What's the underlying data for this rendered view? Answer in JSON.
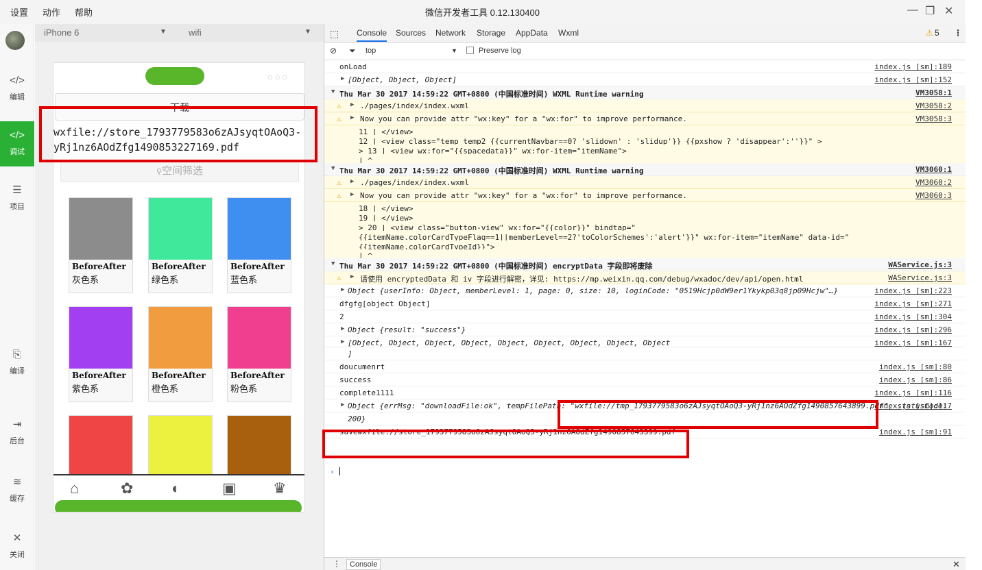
{
  "menu": [
    "设置",
    "动作",
    "帮助"
  ],
  "window_title": "微信开发者工具 0.12.130400",
  "sidebar": [
    {
      "label": "编辑",
      "icon": "code-bracket-icon"
    },
    {
      "label": "调试",
      "icon": "code-slash-icon"
    },
    {
      "label": "项目",
      "icon": "list-icon"
    },
    {
      "label": "编译",
      "icon": "compile-icon"
    },
    {
      "label": "后台",
      "icon": "background-icon"
    },
    {
      "label": "缓存",
      "icon": "layers-icon"
    },
    {
      "label": "关闭",
      "icon": "close-icon"
    }
  ],
  "simulator": {
    "device": "iPhone 6",
    "network": "wifi",
    "download_label": "下载",
    "file_path": "wxfile://store_1793779583o6zAJsyqtOAoQ3-yRj1nz6AOdZfg1490853227169.pdf",
    "filter_label": "空间筛选",
    "cards": [
      {
        "title": "BeforeAfter",
        "name": "灰色系",
        "color": "#8c8c8c"
      },
      {
        "title": "BeforeAfter",
        "name": "绿色系",
        "color": "#3fe89a"
      },
      {
        "title": "BeforeAfter",
        "name": "蓝色系",
        "color": "#3f8ff0"
      },
      {
        "title": "BeforeAfter",
        "name": "紫色系",
        "color": "#a23ff0"
      },
      {
        "title": "BeforeAfter",
        "name": "橙色系",
        "color": "#f09c3f"
      },
      {
        "title": "BeforeAfter",
        "name": "粉色系",
        "color": "#f03f8f"
      },
      {
        "title": "",
        "name": "",
        "color": "#f04545"
      },
      {
        "title": "",
        "name": "",
        "color": "#ecf03f"
      },
      {
        "title": "",
        "name": "",
        "color": "#a8600f"
      }
    ]
  },
  "devtools": {
    "tabs": [
      "Console",
      "Sources",
      "Network",
      "Storage",
      "AppData",
      "Wxml"
    ],
    "warning_count": "5",
    "context": "top",
    "preserve_log": "Preserve log",
    "bottom_tab": "Console",
    "lines": [
      {
        "text": "onLoad",
        "src": "index.js [sm]:189"
      },
      {
        "text": "[Object, Object, Object]",
        "src": "index.js [sm]:152"
      },
      {
        "text": "Thu Mar 30 2017 14:59:22 GMT+0800 (中国标准时间) WXML Runtime warning",
        "src": "VM3058:1"
      },
      {
        "text": "./pages/index/index.wxml",
        "src": "VM3058:2"
      },
      {
        "text": "Now you can provide attr \"wx:key\" for a \"wx:for\" to improve performance.",
        "src": "VM3058:3"
      },
      {
        "text": "  11 | </view>"
      },
      {
        "text": "  12 | <view class=\"temp temp2 {{currentNavbar==0? 'slidown' : 'slidup'}} {{pxshow ? 'disappear':''}}\"  >"
      },
      {
        "text": "> 13 | <view wx:for=\"{{spacedata}}\" wx:for-item=\"itemName\">"
      },
      {
        "text": "     |  ^"
      },
      {
        "text": "Thu Mar 30 2017 14:59:22 GMT+0800 (中国标准时间) WXML Runtime warning",
        "src": "VM3060:1"
      },
      {
        "text": "./pages/index/index.wxml",
        "src": "VM3060:2"
      },
      {
        "text": "Now you can provide attr \"wx:key\" for a \"wx:for\" to improve performance.",
        "src": "VM3060:3"
      },
      {
        "text": "  18 | </view>"
      },
      {
        "text": "  19 |    </view>"
      },
      {
        "text": "> 20 | <view class=\"button-view\" wx:for=\"{{color}}\" bindtap=\""
      },
      {
        "text": "{{itemName.colorCardTypeFlag==1||memberLevel==2?'toColorSchemes':'alert'}}\"  wx:for-item=\"itemName\" data-id=\""
      },
      {
        "text": "{{itemName.colorCardTypeId}}\">"
      },
      {
        "text": "     |  ^"
      },
      {
        "text": "Thu Mar 30 2017 14:59:22 GMT+0800 (中国标准时间) encryptData 字段即将废除",
        "src": "WAService.js:3"
      },
      {
        "text": "请使用 encryptedData 和 iv 字段进行解密，详见: https://mp.weixin.qq.com/debug/wxadoc/dev/api/open.html",
        "src": "WAService.js:3"
      },
      {
        "text": "Object {userInfo: Object, memberLevel: 1, page: 0, size: 10, loginCode: \"0519Hcjp0dW9er1Ykykp03q8jp09Hcjw\"…}",
        "src": "index.js [sm]:223"
      },
      {
        "text": "dfgfg[object Object]",
        "src": "index.js [sm]:271"
      },
      {
        "text": "2",
        "src": "index.js [sm]:304"
      },
      {
        "text": "Object {result: \"success\"}",
        "src": "index.js [sm]:296"
      },
      {
        "text": "[Object, Object, Object, Object, Object, Object, Object, Object, Object",
        "src": "index.js [sm]:167"
      },
      {
        "text": "]"
      },
      {
        "text": "doucumenrt",
        "src": "index.js [sm]:80"
      },
      {
        "text": "success",
        "src": "index.js [sm]:86"
      },
      {
        "text": "complete1111",
        "src": "index.js [sm]:116"
      },
      {
        "text": "Object {errMsg: \"downloadFile:ok\", tempFilePath: \"wxfile://tmp_1793779583o6zAJsyqtOAoQ3-yRj1nz6AOdZfg1490857643899.pdf\", statusCode:",
        "src": "index.js [sm]:117"
      },
      {
        "text": "200}"
      },
      {
        "text": "savewxfile://store_1793779583o6zAJsyqtOAoQ3-yRj1nz6AOdZfg1490857643399.pdf",
        "src": "index.js [sm]:91"
      }
    ]
  }
}
